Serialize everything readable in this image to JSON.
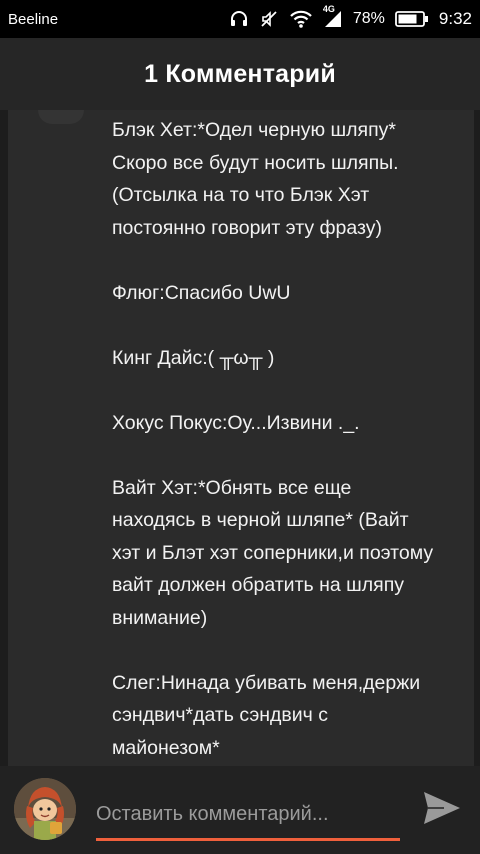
{
  "status_bar": {
    "carrier": "Beeline",
    "network": "4G",
    "battery": "78%",
    "time": "9:32",
    "icons": [
      "headset-icon",
      "mute-icon",
      "wifi-icon",
      "signal-icon",
      "battery-icon"
    ]
  },
  "header": {
    "title": "1 Комментарий"
  },
  "comment": {
    "lines": [
      "Блэк Хет:*Одел черную шляпу*",
      "Скоро все будут носить шляпы.",
      "(Отсылка на то что Блэк Хэт",
      "постоянно говорит эту фразу)",
      "",
      "Флюг:Спасибо UwU",
      "",
      "Кинг Дайс:( ╥ω╥ )",
      "",
      "Хокус Покус:Оу...Извини ._.",
      "",
      "Вайт Хэт:*Обнять все еще",
      "находясь в черной шляпе* (Вайт",
      "хэт и Блэт хэт соперники,и поэтому",
      "вайт должен обратить на шляпу",
      "внимание)",
      "",
      "Слег:Нинада убивать меня,держи",
      "сэндвич*дать сэндвич с",
      "майонезом*"
    ]
  },
  "input_bar": {
    "placeholder": "Оставить комментарий...",
    "value": "",
    "send_icon": "send-icon",
    "accent_color": "#f0603c"
  }
}
